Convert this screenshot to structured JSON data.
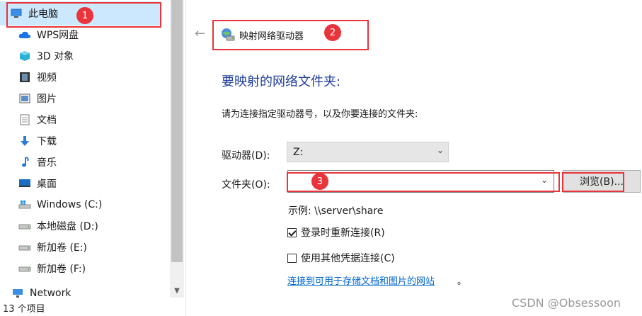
{
  "nav": {
    "items": [
      {
        "label": "此电脑",
        "icon": "computer-icon"
      },
      {
        "label": "WPS网盘",
        "icon": "cloud-icon"
      },
      {
        "label": "3D 对象",
        "icon": "cube-3d-icon"
      },
      {
        "label": "视频",
        "icon": "video-icon"
      },
      {
        "label": "图片",
        "icon": "pictures-icon"
      },
      {
        "label": "文档",
        "icon": "document-icon"
      },
      {
        "label": "下载",
        "icon": "download-icon"
      },
      {
        "label": "音乐",
        "icon": "music-icon"
      },
      {
        "label": "桌面",
        "icon": "desktop-icon"
      },
      {
        "label": "Windows (C:)",
        "icon": "windows-drive-icon"
      },
      {
        "label": "本地磁盘 (D:)",
        "icon": "drive-icon"
      },
      {
        "label": "新加卷 (E:)",
        "icon": "drive-icon"
      },
      {
        "label": "新加卷 (F:)",
        "icon": "drive-icon"
      },
      {
        "label": "Network",
        "icon": "network-icon"
      }
    ],
    "status": "13 个项目"
  },
  "dialog": {
    "title": "映射网络驱动器",
    "heading": "要映射的网络文件夹:",
    "instruction": "请为连接指定驱动器号，以及你要连接的文件夹:",
    "drive_label": "驱动器(D):",
    "drive_value": "Z:",
    "folder_label": "文件夹(O):",
    "folder_value": "",
    "browse_label": "浏览(B)...",
    "example": "示例: \\\\server\\share",
    "reconnect_label": "登录时重新连接(R)",
    "reconnect_checked": true,
    "other_creds_label": "使用其他凭据连接(C)",
    "other_creds_checked": false,
    "link_text": "连接到可用于存储文档和图片的网站",
    "link_suffix": "。"
  },
  "annotations": [
    "1",
    "2",
    "3"
  ],
  "watermark": "CSDN @Obsessoon",
  "colors": {
    "accent": "#1f3e99",
    "link": "#0066cc",
    "annotation": "#e8343a",
    "selection": "#cce8ff"
  }
}
